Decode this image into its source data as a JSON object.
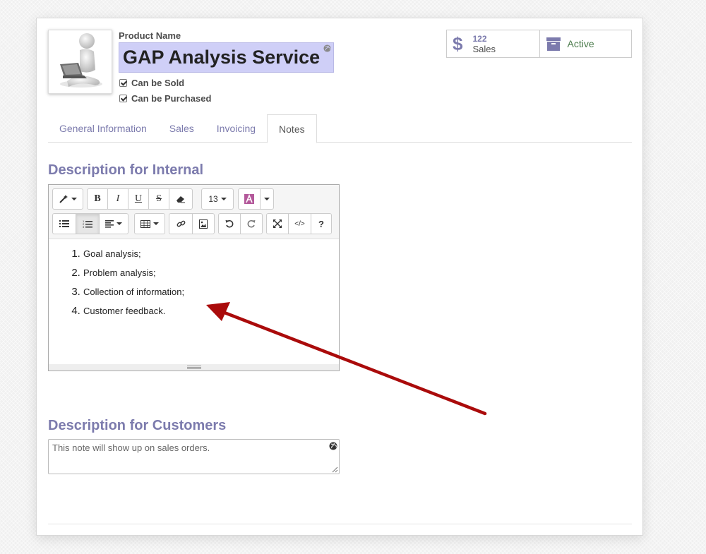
{
  "product": {
    "name_label": "Product Name",
    "name_value": "GAP Analysis Service",
    "can_be_sold_label": "Can be Sold",
    "can_be_sold_checked": true,
    "can_be_purchased_label": "Can be Purchased",
    "can_be_purchased_checked": true
  },
  "stats": {
    "sales_count": "122",
    "sales_label": "Sales",
    "active_label": "Active"
  },
  "tabs": [
    {
      "label": "General Information",
      "active": false
    },
    {
      "label": "Sales",
      "active": false
    },
    {
      "label": "Invoicing",
      "active": false
    },
    {
      "label": "Notes",
      "active": true
    }
  ],
  "internal": {
    "title": "Description for Internal",
    "font_size": "13",
    "items": [
      "Goal analysis;",
      "Problem analysis;",
      "Collection of information;",
      "Customer feedback."
    ]
  },
  "customers": {
    "title": "Description for Customers",
    "placeholder": "This note will show up on sales orders."
  },
  "icons": {
    "accent": "#7c7bad",
    "arrow": "#aa0b0b"
  }
}
